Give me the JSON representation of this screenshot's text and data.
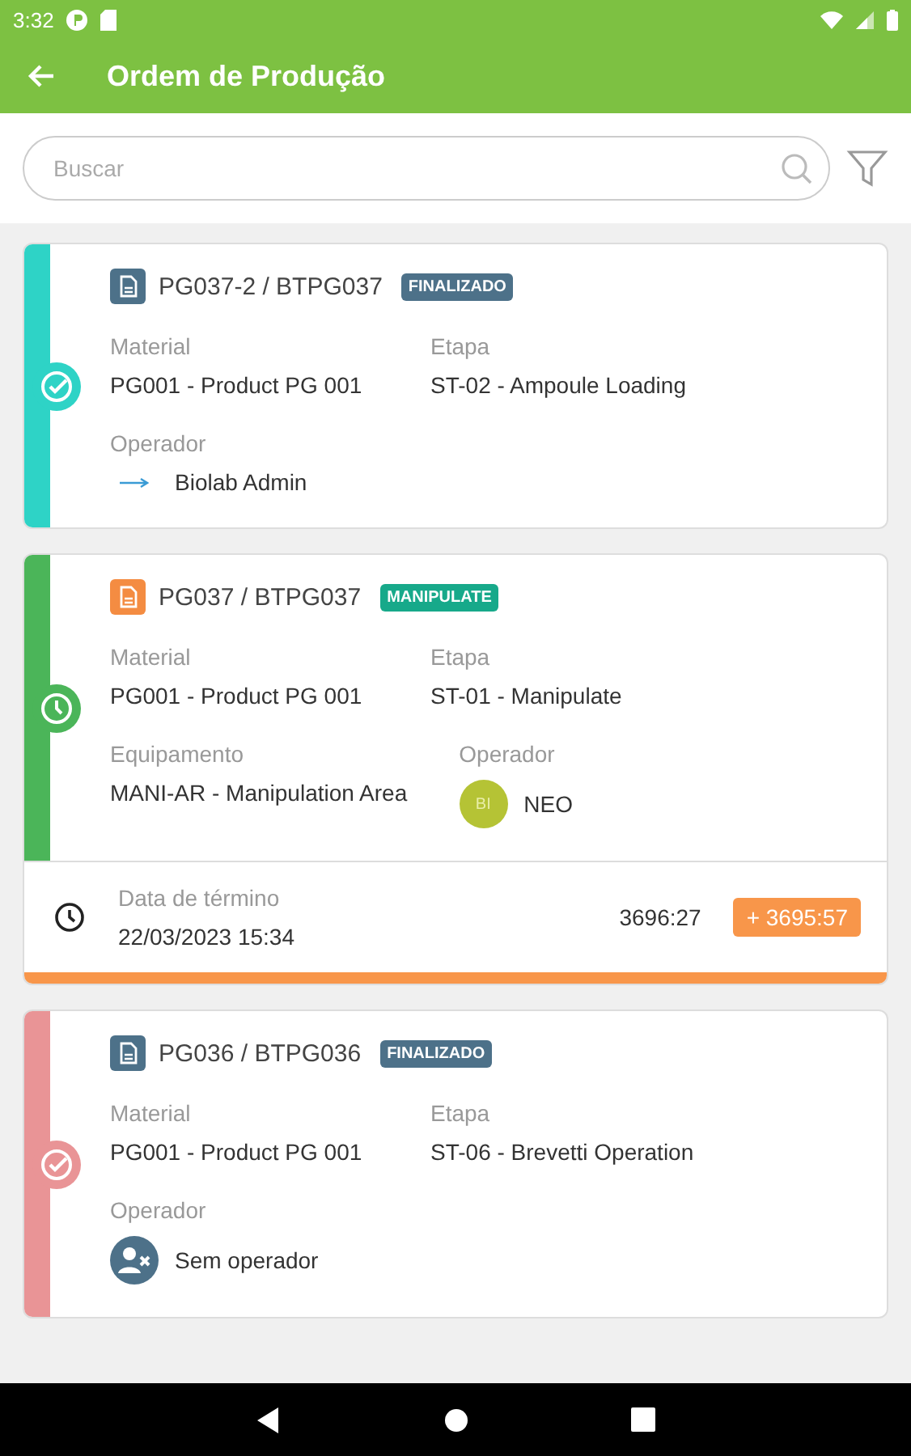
{
  "status_bar": {
    "time": "3:32"
  },
  "toolbar": {
    "title": "Ordem de Produção"
  },
  "search": {
    "placeholder": "Buscar"
  },
  "orders": [
    {
      "kind": "finished",
      "code": "PG037-2 / BTPG037",
      "color": "#2ed3c6",
      "badge": {
        "label": "FINALIZADO",
        "color": "#4d7189"
      },
      "rows": [
        [
          {
            "kind": "text",
            "label": "Material",
            "value": "PG001 - Product PG 001"
          },
          {
            "kind": "text",
            "label": "Etapa",
            "value": "ST-02 - Ampoule Loading"
          }
        ],
        [
          {
            "kind": "logo",
            "label": "Operador",
            "value": "Biolab Admin"
          }
        ]
      ]
    },
    {
      "kind": "in_progress",
      "code": "PG037 / BTPG037",
      "color": "#4bb559",
      "badge": {
        "label": "MANIPULATE",
        "color": "#17a98a"
      },
      "rows": [
        [
          {
            "kind": "text",
            "label": "Material",
            "value": "PG001 - Product PG 001"
          },
          {
            "kind": "text",
            "label": "Etapa",
            "value": "ST-01 - Manipulate"
          }
        ],
        [
          {
            "kind": "text",
            "label": "Equipamento",
            "value": "MANI-AR - Manipulation Area"
          },
          {
            "kind": "initials",
            "label": "Operador",
            "value": "NEO",
            "initials": "BI"
          }
        ]
      ],
      "footer": {
        "label": "Data de término",
        "value": "22/03/2023 15:34",
        "elapsed": "3696:27",
        "overdue": "+ 3695:57"
      }
    },
    {
      "kind": "finished",
      "code": "PG036 / BTPG036",
      "color": "#e99496",
      "badge": {
        "label": "FINALIZADO",
        "color": "#4d7189"
      },
      "rows": [
        [
          {
            "kind": "text",
            "label": "Material",
            "value": "PG001 - Product PG 001"
          },
          {
            "kind": "text",
            "label": "Etapa",
            "value": "ST-06 - Brevetti Operation"
          }
        ],
        [
          {
            "kind": "no_operator",
            "label": "Operador",
            "value": "Sem operador"
          }
        ]
      ]
    }
  ]
}
